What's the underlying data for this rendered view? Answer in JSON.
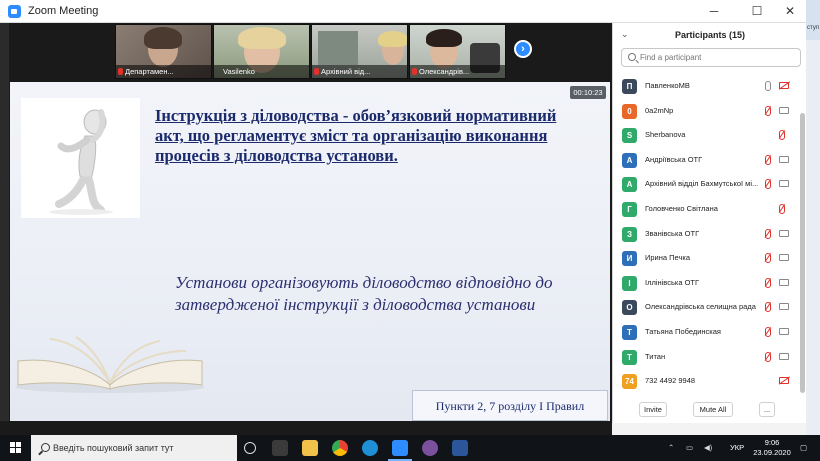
{
  "window": {
    "title": "Zoom Meeting",
    "controls": {
      "minimize": "─",
      "maximize": "☐",
      "close": "✕"
    }
  },
  "background_window": {
    "strip_text": "ступ"
  },
  "thumbnails": [
    {
      "name": "Департамен..."
    },
    {
      "name": "Vasilenko"
    },
    {
      "name": "Архівний від..."
    },
    {
      "name": "Олександрів..."
    }
  ],
  "next_button": "›",
  "slide": {
    "timer": "00:10:23",
    "heading": "Інструкція з діловодства - обов’язковий  нормативний акт, що регламентує зміст та організацію виконання процесів з діловодства установи.",
    "body": "Установи організовують діловодство відповідно до затвердженої інструкції з діловодства установи",
    "footnote": "Пункти 2, 7 розділу I Правил"
  },
  "participants": {
    "title": "Participants (15)",
    "collapse_icon": "chevron-down-icon",
    "search_placeholder": "Find a participant",
    "list": [
      {
        "initial": "П",
        "name": "ПавленкоМВ",
        "color": "#3a4a5c",
        "mic": "on",
        "cam": "off"
      },
      {
        "initial": "0",
        "name": "0a2mNp",
        "color": "#e8682a",
        "mic": "muted",
        "cam": "on"
      },
      {
        "initial": "S",
        "name": "Sherbanova",
        "color": "#2faa6a",
        "mic": "muted",
        "cam": "none"
      },
      {
        "initial": "А",
        "name": "Андріївська ОТГ",
        "color": "#2d6fb8",
        "mic": "muted",
        "cam": "on"
      },
      {
        "initial": "А",
        "name": "Архівний відділ Бахмутської мі...",
        "color": "#2faa6a",
        "mic": "muted",
        "cam": "on"
      },
      {
        "initial": "Г",
        "name": "Головченко Світлана",
        "color": "#2faa6a",
        "mic": "muted",
        "cam": "none"
      },
      {
        "initial": "З",
        "name": "Званівська ОТГ",
        "color": "#2faa6a",
        "mic": "muted",
        "cam": "on"
      },
      {
        "initial": "И",
        "name": "Ирина Печка",
        "color": "#2d6fb8",
        "mic": "muted",
        "cam": "on"
      },
      {
        "initial": "І",
        "name": "Іллінівська ОТГ",
        "color": "#2faa6a",
        "mic": "muted",
        "cam": "on"
      },
      {
        "initial": "О",
        "name": "Олександрівська селищна рада",
        "color": "#3a4a5c",
        "mic": "muted",
        "cam": "on"
      },
      {
        "initial": "Т",
        "name": "Татьяна Побединская",
        "color": "#2d6fb8",
        "mic": "muted",
        "cam": "on"
      },
      {
        "initial": "Т",
        "name": "Титан",
        "color": "#2faa6a",
        "mic": "muted",
        "cam": "on"
      },
      {
        "initial": "74",
        "name": "732 4492 9948",
        "color": "#f0a020",
        "mic": "none",
        "cam": "off"
      }
    ],
    "footer": {
      "invite": "Invite",
      "mute_all": "Mute All",
      "more": "..."
    }
  },
  "taskbar": {
    "search_placeholder": "Введіть пошуковий запит тут",
    "language": "УКР",
    "time": "9:06",
    "date": "23.09.2020",
    "apps": [
      "task-view-icon",
      "calculator-icon",
      "file-explorer-icon",
      "chrome-icon",
      "edge-icon",
      "zoom-icon",
      "viber-icon",
      "word-icon"
    ]
  }
}
